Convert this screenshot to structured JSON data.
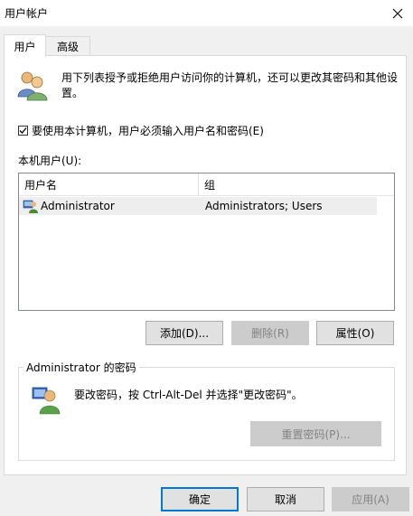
{
  "window": {
    "title": "用户帐户",
    "close_icon": "close-icon"
  },
  "tabs": [
    {
      "label": "用户",
      "active": true
    },
    {
      "label": "高级",
      "active": false
    }
  ],
  "info": {
    "text": "用下列表授予或拒绝用户访问你的计算机，还可以更改其密码和其他设置。",
    "icon": "users-icon"
  },
  "require_login": {
    "label": "要使用本计算机，用户必须输入用户名和密码(E)",
    "checked": true
  },
  "users_list": {
    "label": "本机用户(U):",
    "columns": [
      "用户名",
      "组"
    ],
    "rows": [
      {
        "username": "Administrator",
        "group": "Administrators; Users",
        "icon": "user-icon"
      }
    ]
  },
  "list_buttons": {
    "add": "添加(D)...",
    "remove": "删除(R)",
    "properties": "属性(O)"
  },
  "password_group": {
    "title": "Administrator 的密码",
    "text": "要改密码，按 Ctrl-Alt-Del 并选择\"更改密码\"。",
    "reset_button": "重置密码(P)...",
    "icon": "user-password-icon"
  },
  "dialog_buttons": {
    "ok": "确定",
    "cancel": "取消",
    "apply": "应用(A)"
  },
  "colors": {
    "accent": "#0078d7",
    "window_bg": "#f0f0f0",
    "panel_bg": "#ffffff"
  }
}
